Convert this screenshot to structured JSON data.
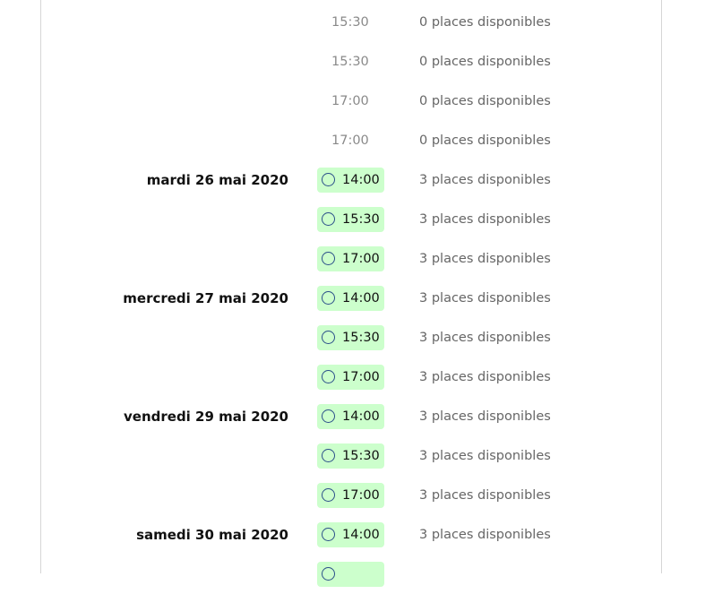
{
  "rows": [
    {
      "date": "",
      "time": "15:30",
      "available": false,
      "places": "0 places disponibles"
    },
    {
      "date": "",
      "time": "15:30",
      "available": false,
      "places": "0 places disponibles"
    },
    {
      "date": "",
      "time": "17:00",
      "available": false,
      "places": "0 places disponibles"
    },
    {
      "date": "",
      "time": "17:00",
      "available": false,
      "places": "0 places disponibles"
    },
    {
      "date": "mardi 26 mai 2020",
      "time": "14:00",
      "available": true,
      "places": "3 places disponibles"
    },
    {
      "date": "",
      "time": "15:30",
      "available": true,
      "places": "3 places disponibles"
    },
    {
      "date": "",
      "time": "17:00",
      "available": true,
      "places": "3 places disponibles"
    },
    {
      "date": "mercredi 27 mai 2020",
      "time": "14:00",
      "available": true,
      "places": "3 places disponibles"
    },
    {
      "date": "",
      "time": "15:30",
      "available": true,
      "places": "3 places disponibles"
    },
    {
      "date": "",
      "time": "17:00",
      "available": true,
      "places": "3 places disponibles"
    },
    {
      "date": "vendredi 29 mai 2020",
      "time": "14:00",
      "available": true,
      "places": "3 places disponibles"
    },
    {
      "date": "",
      "time": "15:30",
      "available": true,
      "places": "3 places disponibles"
    },
    {
      "date": "",
      "time": "17:00",
      "available": true,
      "places": "3 places disponibles"
    },
    {
      "date": "samedi 30 mai 2020",
      "time": "14:00",
      "available": true,
      "places": "3 places disponibles"
    },
    {
      "date": "",
      "time": "",
      "available": true,
      "places": ""
    }
  ],
  "colors": {
    "slot_bg": "#ccffcc",
    "radio_border": "#2b4f8a",
    "disabled_time": "#8a8a8a",
    "places_text": "#666666"
  }
}
